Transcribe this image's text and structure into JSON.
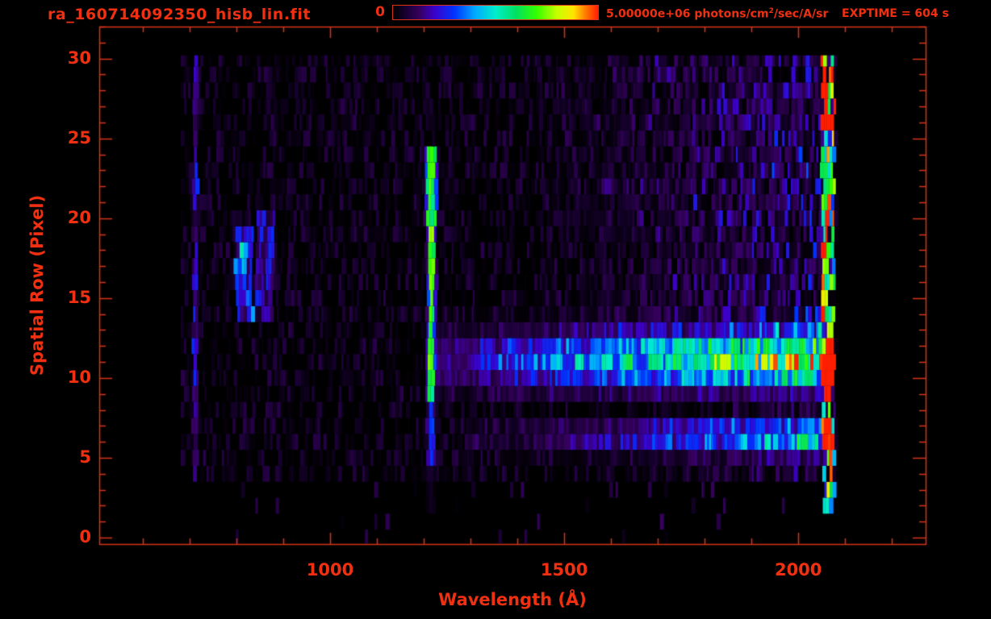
{
  "header": {
    "filename": "ra_160714092350_hisb_lin.fit",
    "colorbar_min_label": "0",
    "colorbar_max_prefix": "5.00000e+06 photons/cm",
    "colorbar_max_sup": "2",
    "colorbar_max_suffix": "/sec/A/sr",
    "exptime_label": "EXPTIME = 604 s"
  },
  "colors": {
    "background": "#000000",
    "text_red": "#f03010",
    "line_red": "#d8341a"
  },
  "chart_data": {
    "type": "heatmap",
    "title": "ra_160714092350_hisb_lin.fit",
    "xlabel": "Wavelength (Å)",
    "ylabel": "Spatial Row (Pixel)",
    "x_range": [
      507,
      2272
    ],
    "y_range": [
      -0.4,
      32.0
    ],
    "x_ticks_major": [
      1000,
      1500,
      2000
    ],
    "x_tick_minor_step_A": 100,
    "y_ticks_major": [
      0,
      5,
      10,
      15,
      20,
      25,
      30
    ],
    "y_tick_minor_step": 1,
    "colorbar": {
      "min_value": 0,
      "max_value": 5000000,
      "units": "photons/cm^2/sec/A/sr"
    },
    "exposure_time_s": 604,
    "data_extent": {
      "wavelength_A": [
        681,
        2078
      ],
      "rows": [
        0,
        30.2
      ]
    },
    "colormap_stops": [
      [
        0,
        "#000000"
      ],
      [
        0.06,
        "#17002f"
      ],
      [
        0.13,
        "#36005f"
      ],
      [
        0.2,
        "#3c00c8"
      ],
      [
        0.3,
        "#0033ff"
      ],
      [
        0.4,
        "#00aaff"
      ],
      [
        0.5,
        "#00eecc"
      ],
      [
        0.6,
        "#00e060"
      ],
      [
        0.7,
        "#33ff00"
      ],
      [
        0.8,
        "#c8ff00"
      ],
      [
        0.88,
        "#ffe400"
      ],
      [
        0.94,
        "#ff7a00"
      ],
      [
        1,
        "#ff1e00"
      ]
    ],
    "features": [
      {
        "name": "background-speckle",
        "rows": [
          3.8,
          30.2
        ],
        "fill": 0.8,
        "amp": 0.1
      },
      {
        "name": "sparse-bottom-rows",
        "rows": [
          0,
          3.8
        ],
        "fill": 0.05,
        "amp": 0.13
      },
      {
        "name": "upper-right-noise-boost",
        "rows": [
          12.5,
          30.2
        ],
        "wavelength_A": [
          1450,
          2078
        ],
        "amp": 0.3
      },
      {
        "name": "lower-right-noise-boost",
        "rows": [
          3.8,
          8.8
        ],
        "wavelength_A": [
          1600,
          2078
        ],
        "amp": 0.16
      },
      {
        "name": "faint-airglow-line",
        "wavelength_A": 712,
        "halfwidth_A": 5,
        "rows": [
          3.8,
          30.2
        ],
        "amp": [
          0.07,
          0.2
        ]
      },
      {
        "name": "airglow-patch-1",
        "wavelength_A": [
          798,
          836
        ],
        "rows": [
          13.4,
          19.6
        ],
        "amp": [
          0.1,
          0.34
        ],
        "hotspot": {
          "wavelength_A": [
            806,
            820
          ],
          "rows": [
            16.4,
            18.3
          ],
          "amp": 0.28
        }
      },
      {
        "name": "airglow-patch-2",
        "wavelength_A": [
          842,
          880
        ],
        "rows": [
          14,
          20.6
        ],
        "amp": [
          0.05,
          0.26
        ]
      },
      {
        "name": "lyman-alpha-emission-line",
        "wavelength_A": 1216,
        "core_halfwidth_A": 5.5,
        "core_halfwidth_wide_A": 10,
        "wide_top_rows": [
          19.4,
          24.8
        ],
        "wing_extra_A": 7,
        "segments": [
          {
            "rows": [
              12.4,
              24.8
            ],
            "amp": 0.55,
            "amp_jitter": 0.18
          },
          {
            "rows": [
              8.9,
              12.4
            ],
            "amp": 0.5,
            "amp_jitter": 0.12
          },
          {
            "rows": [
              4.4,
              8.9
            ],
            "amp": 0.18,
            "amp_jitter": 0.12
          },
          {
            "rows": [
              1.9,
              4.4
            ],
            "amp": 0.03,
            "amp_jitter": 0.06
          }
        ]
      },
      {
        "name": "continuum-spectrum-band",
        "row_center": 11.1,
        "row_sigma": 1.6,
        "wavelength_A": [
          1205,
          2078
        ],
        "amp_ramp": [
          0.12,
          0.82
        ],
        "ramp_span_A": 800
      },
      {
        "name": "secondary-spectrum-band",
        "row_center": 6.3,
        "row_sigma": 0.95,
        "wavelength_A": [
          1290,
          2078
        ],
        "amp_ramp": [
          0.05,
          0.55
        ]
      },
      {
        "name": "detector-edge-column",
        "wavelength_A": [
          2050,
          2078
        ],
        "rows": [
          1.5,
          30.2
        ],
        "fill": 0.78,
        "amp": [
          0.25,
          0.95
        ],
        "hot_boost": 0.3,
        "hot_rows": [
          [
            8.9,
            12.1
          ],
          [
            25.9,
            29.1
          ]
        ]
      }
    ]
  }
}
